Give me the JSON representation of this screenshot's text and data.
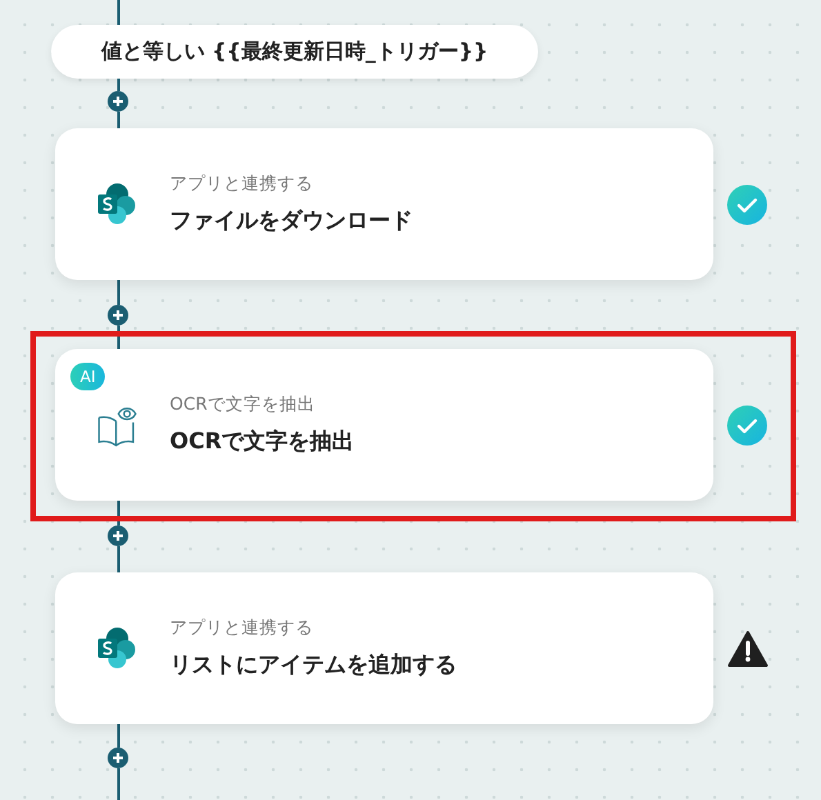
{
  "steps": [
    {
      "kind": "condition",
      "text": "値と等しい {{最終更新日時_トリガー}}"
    },
    {
      "kind": "app",
      "caption": "アプリと連携する",
      "title": "ファイルをダウンロード",
      "completed": true,
      "highlighted": false
    },
    {
      "kind": "ocr",
      "badge": "AI",
      "caption": "OCRで文字を抽出",
      "title": "OCRで文字を抽出",
      "completed": true,
      "highlighted": true
    },
    {
      "kind": "app",
      "caption": "アプリと連携する",
      "title": "リストにアイテムを追加する",
      "completed": false,
      "highlighted": false
    }
  ]
}
